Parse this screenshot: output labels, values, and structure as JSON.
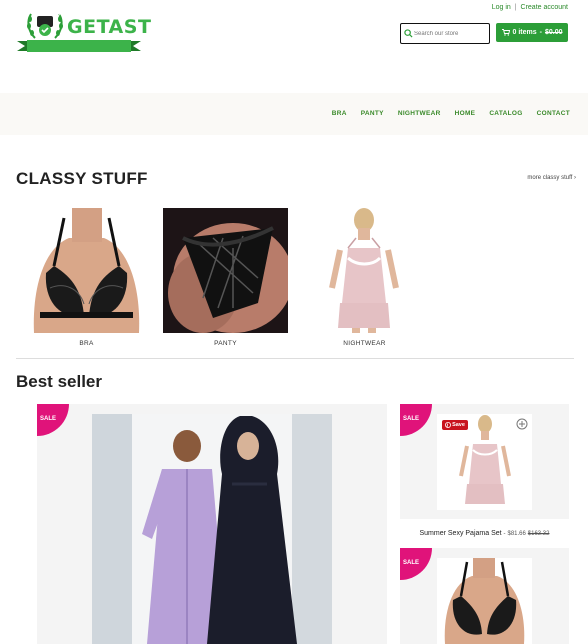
{
  "brand": {
    "name": "GETAST",
    "tagline": "get a stuff",
    "color": "#3cb34a"
  },
  "account": {
    "login": "Log in",
    "separator": "|",
    "create": "Create account"
  },
  "search": {
    "placeholder": "Search our store"
  },
  "cart": {
    "items": "0 items",
    "dash": "-",
    "total": "$0.00"
  },
  "nav": {
    "items": [
      "BRA",
      "PANTY",
      "NIGHTWEAR",
      "HOME",
      "CATALOG",
      "CONTACT"
    ]
  },
  "classy": {
    "title": "CLASSY STUFF",
    "more": "more classy stuff ›",
    "categories": [
      {
        "label": "BRA",
        "icon": "bra-photo"
      },
      {
        "label": "PANTY",
        "icon": "panty-photo"
      },
      {
        "label": "NIGHTWEAR",
        "icon": "nightwear-photo"
      }
    ]
  },
  "best_seller": {
    "title": "Best seller",
    "sale_badge": "SALE",
    "save_button": "Save",
    "product1": {
      "name": "Summer Sexy Pajama Set",
      "separator": "-",
      "price": "$81.66",
      "old_price": "$163.32"
    }
  },
  "colors": {
    "accent": "#2c9e38",
    "sale": "#e0137a",
    "pinterest": "#c8141e"
  }
}
